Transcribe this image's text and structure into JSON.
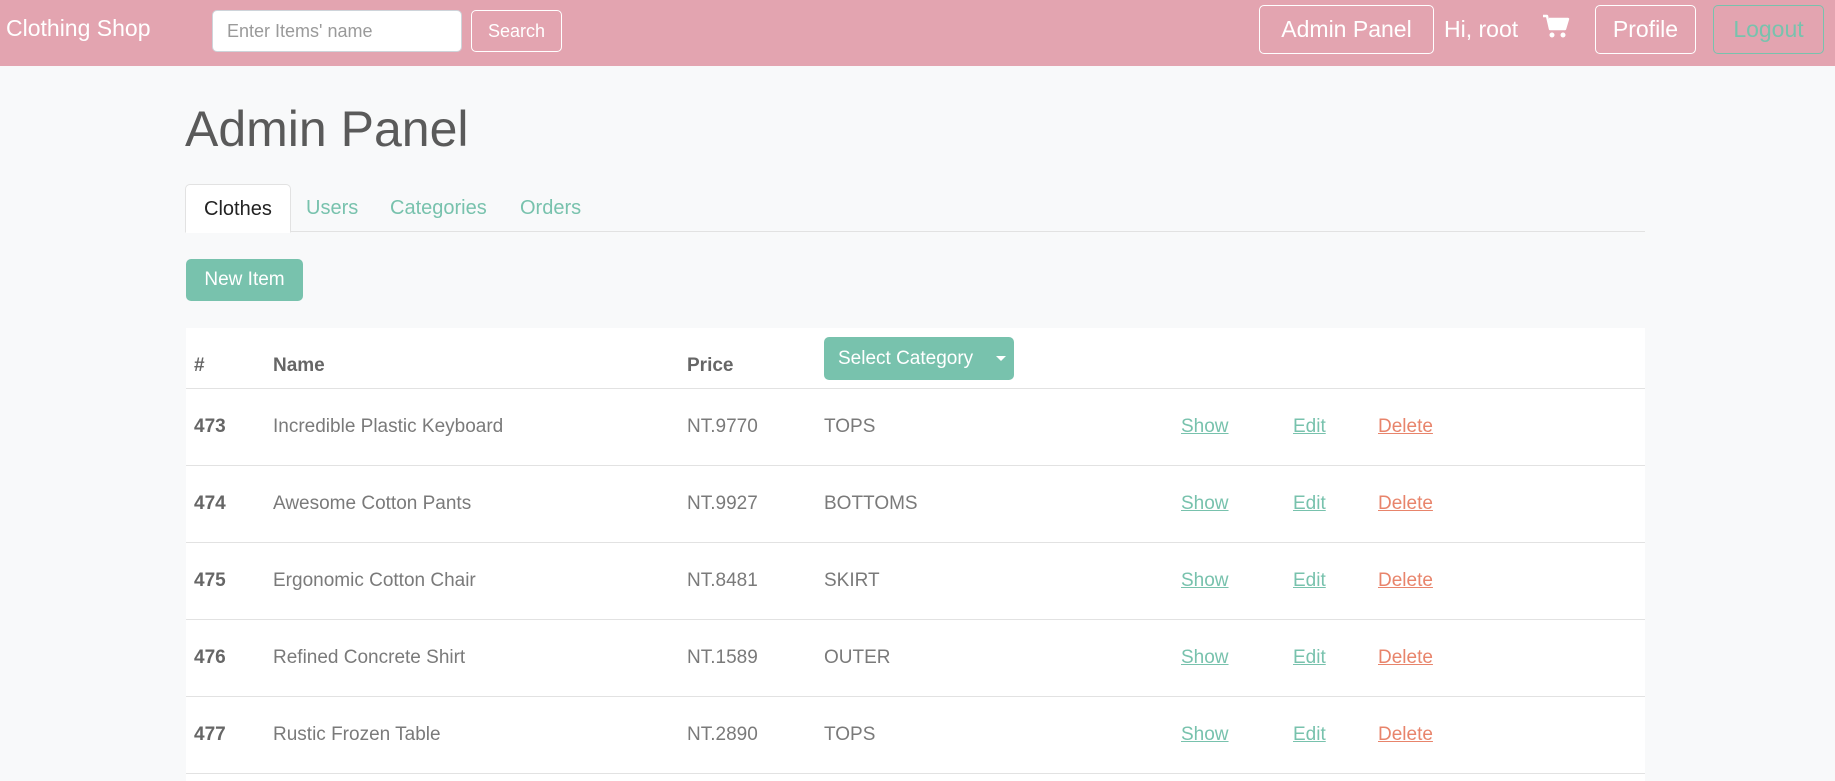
{
  "navbar": {
    "brand": "Clothing Shop",
    "search_placeholder": "Enter Items' name",
    "search_label": "Search",
    "admin_label": "Admin Panel",
    "greeting": "Hi, root",
    "cart_icon": "shopping-cart-icon",
    "profile_label": "Profile",
    "logout_label": "Logout"
  },
  "page": {
    "title": "Admin Panel",
    "tabs": [
      {
        "label": "Clothes",
        "active": true
      },
      {
        "label": "Users",
        "active": false
      },
      {
        "label": "Categories",
        "active": false
      },
      {
        "label": "Orders",
        "active": false
      }
    ],
    "new_item_label": "New Item"
  },
  "table": {
    "headers": {
      "id": "#",
      "name": "Name",
      "price": "Price"
    },
    "category_filter_label": "Select Category",
    "rows": [
      {
        "id": "473",
        "name": "Incredible Plastic Keyboard",
        "price": "NT.9770",
        "category": "TOPS"
      },
      {
        "id": "474",
        "name": "Awesome Cotton Pants",
        "price": "NT.9927",
        "category": "BOTTOMS"
      },
      {
        "id": "475",
        "name": "Ergonomic Cotton Chair",
        "price": "NT.8481",
        "category": "SKIRT"
      },
      {
        "id": "476",
        "name": "Refined Concrete Shirt",
        "price": "NT.1589",
        "category": "OUTER"
      },
      {
        "id": "477",
        "name": "Rustic Frozen Table",
        "price": "NT.2890",
        "category": "TOPS"
      }
    ],
    "actions": {
      "show": "Show",
      "edit": "Edit",
      "delete": "Delete"
    }
  },
  "colors": {
    "navbar": "#e3a4b0",
    "primary": "#78c2ad",
    "danger": "#e8846b",
    "background": "#f8f9fa"
  }
}
